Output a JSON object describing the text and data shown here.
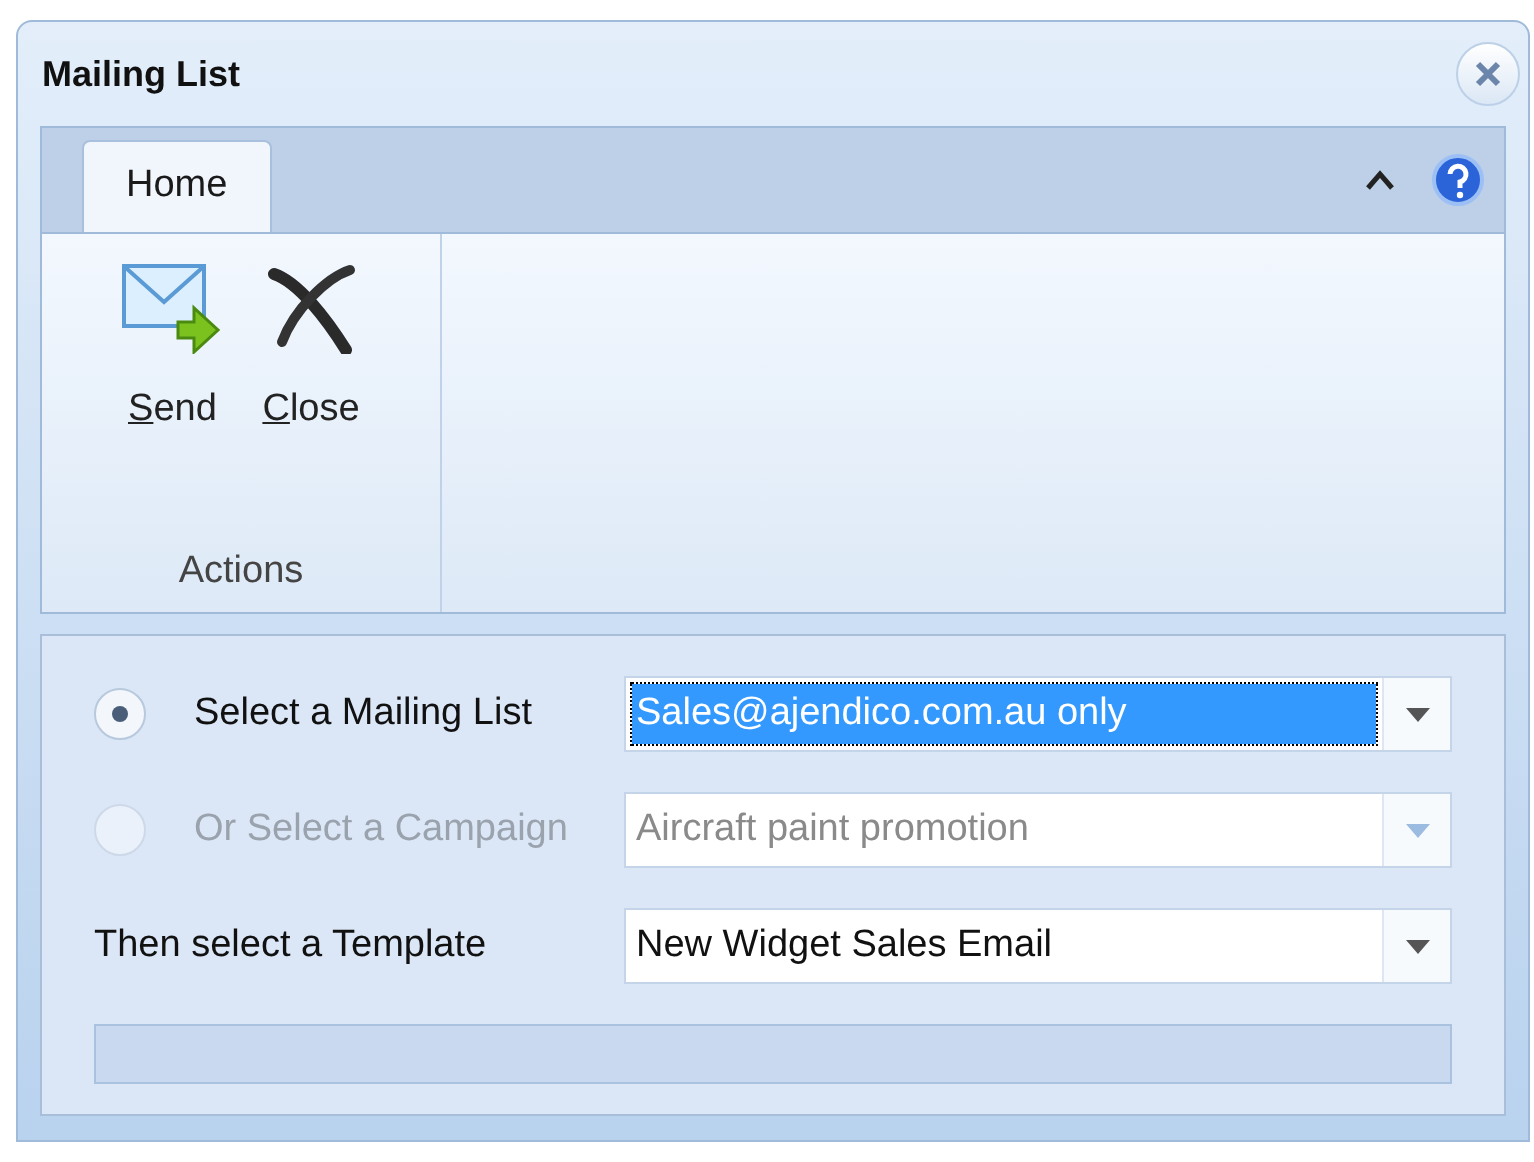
{
  "window": {
    "title": "Mailing List"
  },
  "ribbon": {
    "tabs": [
      {
        "label": "Home",
        "selected": true
      }
    ],
    "groups": [
      {
        "label": "Actions",
        "buttons": [
          {
            "kind": "send",
            "label": "Send",
            "underline_first": true
          },
          {
            "kind": "close",
            "label": "Close",
            "underline_first": true
          }
        ]
      }
    ]
  },
  "form": {
    "rows": [
      {
        "kind": "radio",
        "label": "Select a Mailing List",
        "selected": true,
        "disabled": false,
        "value": "Sales@ajendico.com.au only",
        "highlighted": true
      },
      {
        "kind": "radio",
        "label": "Or Select a Campaign",
        "selected": false,
        "disabled": true,
        "value": "Aircraft paint promotion",
        "highlighted": false
      },
      {
        "kind": "label",
        "label": "Then select a Template",
        "disabled": false,
        "value": "New Widget Sales Email",
        "highlighted": false
      }
    ]
  },
  "progress": {
    "level": 0
  }
}
